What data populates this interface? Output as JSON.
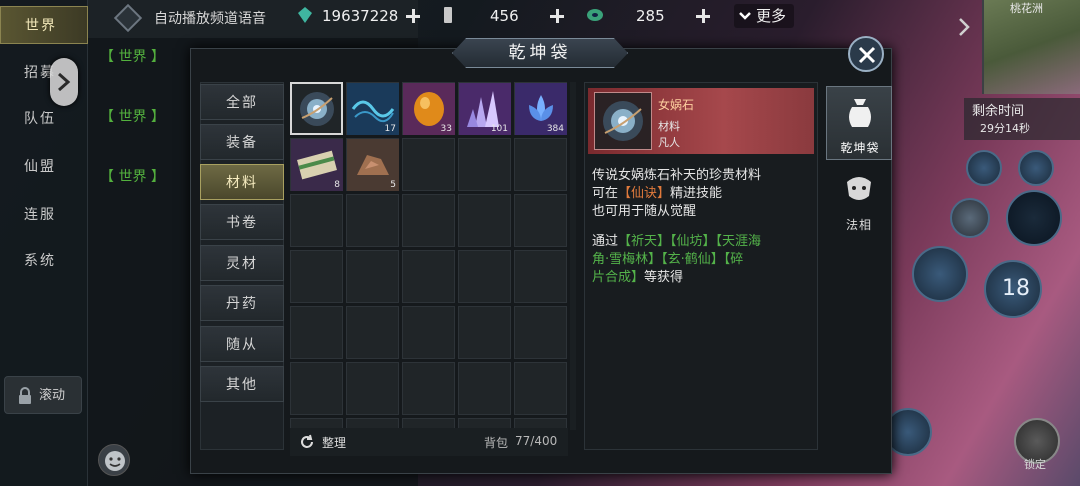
{
  "chat": {
    "nav": [
      "世界",
      "招募",
      "队伍",
      "仙盟",
      "连服",
      "系统"
    ],
    "scroll_label": "滚动",
    "channel_voice": "自动播放频道语音",
    "world_tag": "【 世界 】"
  },
  "currency": {
    "jade": "19637228",
    "ticket": "456",
    "coin": "285",
    "more": "更多"
  },
  "hud": {
    "minimap_name": "桃花洲",
    "timer_title": "剩余时间",
    "timer_value": "29分14秒",
    "skill_count": "18",
    "lock_label": "锁定"
  },
  "panel": {
    "title": "乾坤袋",
    "categories": [
      "全部",
      "装备",
      "材料",
      "书卷",
      "灵材",
      "丹药",
      "随从",
      "其他"
    ],
    "active_category": "材料",
    "items": [
      {
        "icon": "nuwa-stone-icon",
        "qty": ""
      },
      {
        "icon": "blue-rope-icon",
        "qty": "17"
      },
      {
        "icon": "amber-icon",
        "qty": "33"
      },
      {
        "icon": "crystal-icon",
        "qty": "101"
      },
      {
        "icon": "lotus-icon",
        "qty": "384"
      },
      {
        "icon": "scroll-icon",
        "qty": "8"
      },
      {
        "icon": "ore-icon",
        "qty": "5"
      }
    ],
    "sort_label": "整理",
    "bag_label": "背包",
    "bag_value": "77/400"
  },
  "detail": {
    "name": "女娲石",
    "type": "材料",
    "rarity": "凡人",
    "desc1": "传说女娲炼石补天的珍贵材料",
    "desc2_pre": "可在",
    "desc2_hl": "【仙诀】",
    "desc2_post": "精进技能",
    "desc3": "也可用于随从觉醒",
    "src1_pre": "通过",
    "src1_a": "【祈天】【仙坊】【天涯海",
    "src2_a": "角·雪梅林】【玄·鹤仙】【碎",
    "src3_a": "片合成】",
    "src3_post": "等获得"
  },
  "side_tabs": [
    "乾坤袋",
    "法相"
  ],
  "colors": {
    "accent_gold": "#a8a060",
    "rarity_red": "#a6484c",
    "source_green": "#54b34a",
    "highlight_orange": "#e07a3c"
  }
}
